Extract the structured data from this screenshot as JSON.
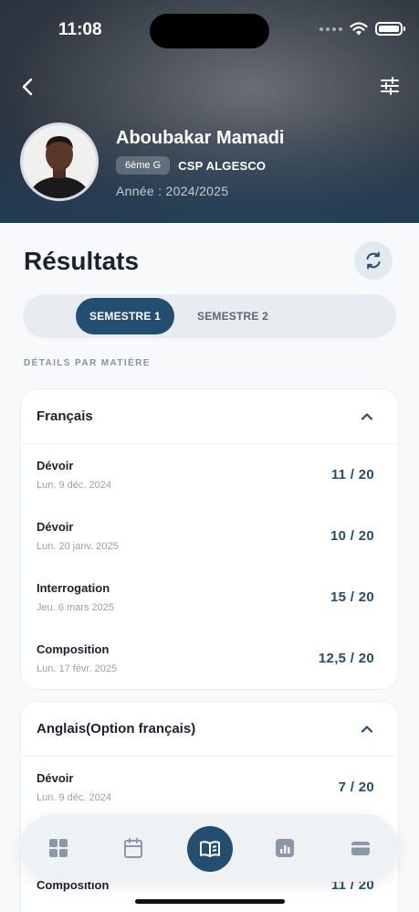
{
  "status_bar": {
    "time": "11:08"
  },
  "profile": {
    "name": "Aboubakar Mamadi",
    "class": "6ème G",
    "school": "CSP ALGESCO",
    "year": "Année : 2024/2025"
  },
  "page": {
    "title": "Résultats",
    "section_label": "DÉTAILS PAR MATIÈRE"
  },
  "tabs": [
    {
      "label": "SEMESTRE 1",
      "active": true
    },
    {
      "label": "SEMESTRE 2",
      "active": false
    }
  ],
  "subjects": [
    {
      "name": "Français",
      "expanded": true,
      "evaluations": [
        {
          "type": "Dévoir",
          "date": "Lun. 9 déc. 2024",
          "grade": "11 / 20"
        },
        {
          "type": "Dévoir",
          "date": "Lun. 20 janv. 2025",
          "grade": "10 / 20"
        },
        {
          "type": "Interrogation",
          "date": "Jeu. 6 mars 2025",
          "grade": "15 / 20"
        },
        {
          "type": "Composition",
          "date": "Lun. 17 févr. 2025",
          "grade": "12,5 / 20"
        }
      ]
    },
    {
      "name": "Anglais(Option français)",
      "expanded": true,
      "evaluations": [
        {
          "type": "Dévoir",
          "date": "Lun. 9 déc. 2024",
          "grade": "7 / 20"
        },
        {
          "type": "Composition",
          "date": "",
          "grade": "11 / 20"
        }
      ]
    }
  ],
  "nav": {
    "items": [
      "dashboard-icon",
      "calendar-icon",
      "book-icon",
      "chart-icon",
      "wallet-icon"
    ],
    "active": "book-icon"
  },
  "colors": {
    "accent": "#234e70",
    "background": "#f7f9fb"
  }
}
